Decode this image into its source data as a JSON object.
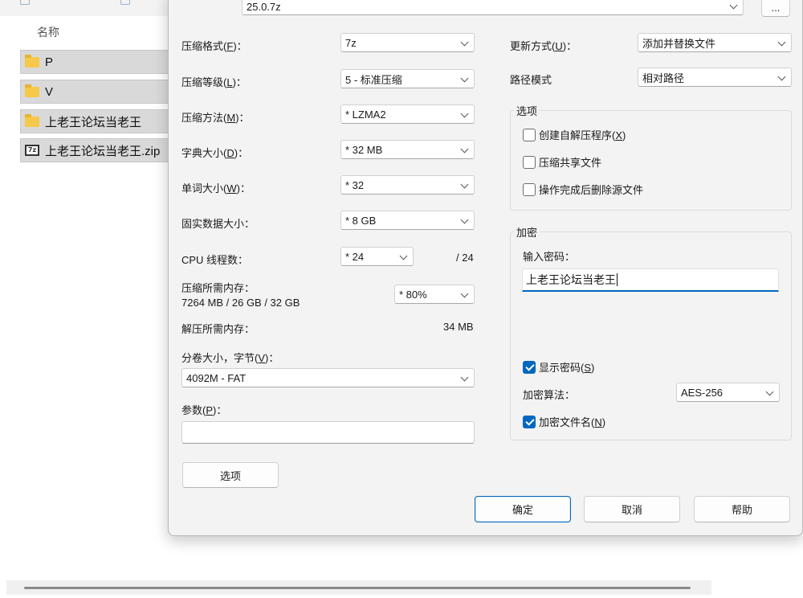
{
  "explorer": {
    "column_name": "名称",
    "files": [
      {
        "name": "P",
        "type": "folder"
      },
      {
        "name": "V",
        "type": "folder"
      },
      {
        "name": "上老王论坛当老王",
        "type": "folder"
      },
      {
        "name": "上老王论坛当老王.zip",
        "type": "7z-archive",
        "icon_text": "7z"
      }
    ]
  },
  "dialog": {
    "archive": {
      "value": "25.0.7z",
      "browse_label": "..."
    },
    "left": {
      "format": {
        "label": "压缩格式",
        "key": "F",
        "value": "7z"
      },
      "level": {
        "label": "压缩等级",
        "key": "L",
        "value": "5 - 标准压缩"
      },
      "method": {
        "label": "压缩方法",
        "key": "M",
        "value": "* LZMA2"
      },
      "dict": {
        "label": "字典大小",
        "key": "D",
        "value": "* 32 MB"
      },
      "word": {
        "label": "单词大小",
        "key": "W",
        "value": "* 32"
      },
      "solid": {
        "label": "固实数据大小：",
        "value": "* 8 GB"
      },
      "threads": {
        "label": "CPU 线程数：",
        "value": "* 24",
        "max": "/ 24"
      },
      "mem_compress": {
        "label": "压缩所需内存：",
        "detail": "7264 MB / 26 GB / 32 GB",
        "value": "* 80%"
      },
      "mem_decompress": {
        "label": "解压所需内存：",
        "value": "34 MB"
      },
      "volume": {
        "label": "分卷大小，字节",
        "key": "V",
        "value": "4092M - FAT"
      },
      "params": {
        "label": "参数",
        "key": "P",
        "value": ""
      },
      "options_button": "选项"
    },
    "right": {
      "update": {
        "label": "更新方式",
        "key": "U",
        "value": "添加并替换文件"
      },
      "path": {
        "label": "路径模式",
        "value": "相对路径"
      },
      "options_group": {
        "title": "选项",
        "sfx": {
          "label": "创建自解压程序",
          "key": "X",
          "checked": false
        },
        "shared": {
          "label": "压缩共享文件",
          "checked": false
        },
        "delete": {
          "label": "操作完成后删除源文件",
          "checked": false
        }
      },
      "encryption": {
        "title": "加密",
        "password_label": "输入密码：",
        "password_value": "上老王论坛当老王",
        "show_password": {
          "label": "显示密码",
          "key": "S",
          "checked": true
        },
        "method_label": "加密算法：",
        "method_value": "AES-256",
        "encrypt_names": {
          "label": "加密文件名",
          "key": "N",
          "checked": true
        }
      }
    },
    "buttons": {
      "ok": "确定",
      "cancel": "取消",
      "help": "帮助"
    }
  }
}
